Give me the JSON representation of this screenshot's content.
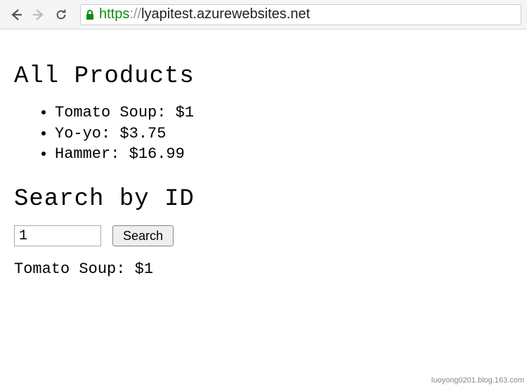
{
  "browser": {
    "url_scheme": "https",
    "url_sep": "://",
    "url_host": "lyapitest.azurewebsites.net"
  },
  "page": {
    "heading_all": "All Products",
    "products": [
      {
        "name": "Tomato Soup",
        "price": "$1"
      },
      {
        "name": "Yo-yo",
        "price": "$3.75"
      },
      {
        "name": "Hammer",
        "price": "$16.99"
      }
    ],
    "heading_search": "Search by ID",
    "search": {
      "input_value": "1",
      "button_label": "Search"
    },
    "result": {
      "name": "Tomato Soup",
      "price": "$1"
    }
  },
  "watermark": "luoyong0201.blog.163.com"
}
